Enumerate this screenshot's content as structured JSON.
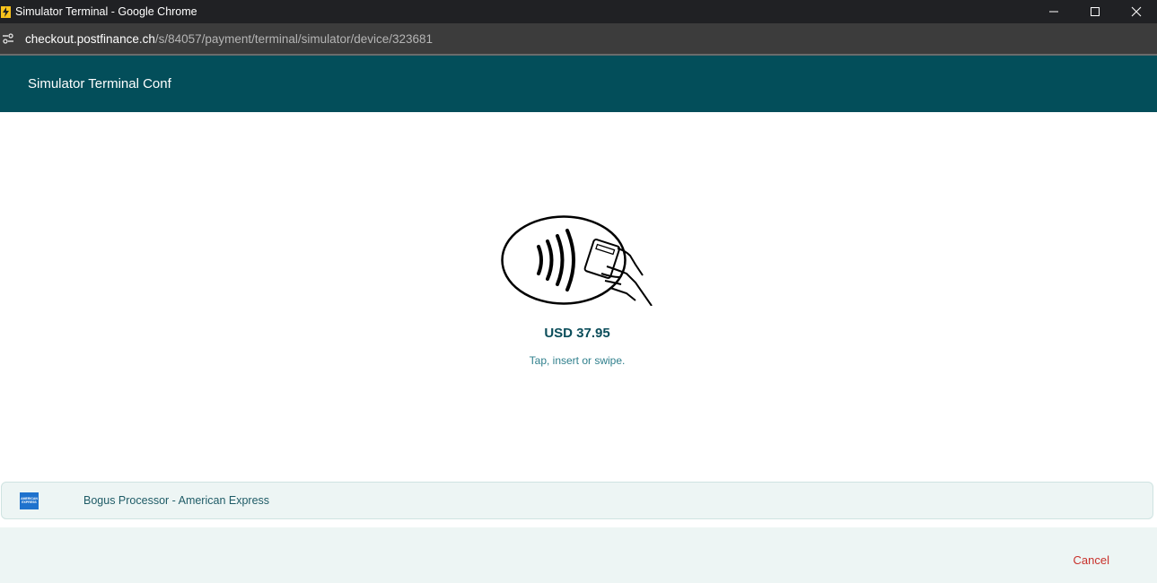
{
  "window": {
    "title": "Simulator Terminal - Google Chrome",
    "controls": [
      "minimize-icon",
      "maximize-icon",
      "close-icon"
    ]
  },
  "address_bar": {
    "host": "checkout.postfinance.ch",
    "path": "/s/84057/payment/terminal/simulator/device/323681"
  },
  "header": {
    "title": "Simulator Terminal Conf"
  },
  "terminal": {
    "icon": "contactless-payment-icon",
    "amount": "USD 37.95",
    "instruction": "Tap, insert or swipe."
  },
  "processor": {
    "icon": "american-express-logo",
    "label": "Bogus Processor - American Express"
  },
  "footer": {
    "cancel_label": "Cancel"
  },
  "colors": {
    "header_bg": "#034e5a",
    "amount_text": "#0b4d5a",
    "instruction_text": "#2f7f8c",
    "panel_bg": "#edf5f4",
    "cancel_text": "#c8302a"
  }
}
